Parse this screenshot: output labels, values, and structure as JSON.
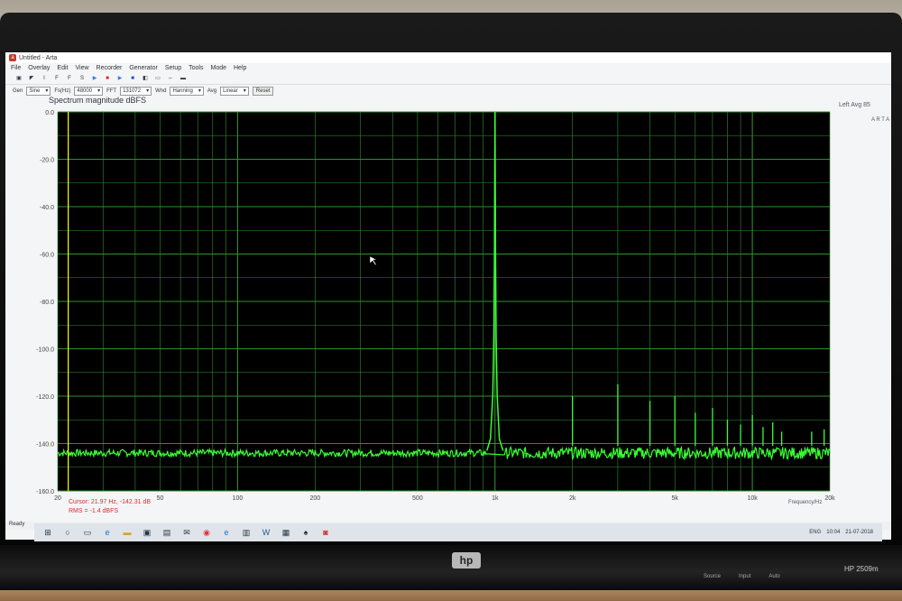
{
  "window": {
    "title": "Untitled - Arta"
  },
  "menu": [
    "File",
    "Overlay",
    "Edit",
    "View",
    "Recorder",
    "Generator",
    "Setup",
    "Tools",
    "Mode",
    "Help"
  ],
  "toolbar": {
    "labels": [
      "Gen",
      "Fs(Hz)",
      "FFT",
      "Wnd",
      "Avg"
    ],
    "values": [
      "Sine",
      "48000",
      "131072",
      "Hanning",
      "Linear"
    ],
    "reset": "Reset"
  },
  "chart_data": {
    "type": "line",
    "title": "Spectrum magnitude dBFS",
    "corner_label": "Left  Avg 85",
    "side_label": "A R T A",
    "xlabel": "Frequency/Hz",
    "ylabel": "",
    "xscale": "log",
    "xlim": [
      20,
      20000
    ],
    "ylim": [
      -160,
      0
    ],
    "yticks": [
      "0.0",
      "-20.0",
      "-40.0",
      "-60.0",
      "-80.0",
      "-100.0",
      "-120.0",
      "-140.0",
      "-160.0"
    ],
    "xticks": [
      "20",
      "50",
      "100",
      "200",
      "500",
      "1k",
      "2k",
      "5k",
      "10k",
      "20k"
    ],
    "grid": true,
    "noise_floor_db": -143,
    "series": [
      {
        "fundamental": {
          "x": 1000,
          "y": 0
        },
        "harmonics": [
          {
            "x": 2000,
            "y": -120
          },
          {
            "x": 3000,
            "y": -115
          },
          {
            "x": 4000,
            "y": -122
          },
          {
            "x": 5000,
            "y": -120
          },
          {
            "x": 6000,
            "y": -127
          },
          {
            "x": 7000,
            "y": -125
          },
          {
            "x": 8000,
            "y": -130
          },
          {
            "x": 9000,
            "y": -132
          },
          {
            "x": 10000,
            "y": -128
          },
          {
            "x": 11000,
            "y": -133
          },
          {
            "x": 12000,
            "y": -131
          },
          {
            "x": 13000,
            "y": -135
          },
          {
            "x": 17000,
            "y": -135
          },
          {
            "x": 19000,
            "y": -134
          }
        ]
      }
    ],
    "colors": {
      "trace": "#39ff33",
      "grid": "#2f8f2f",
      "background": "#000000",
      "cursor": "#ffff00"
    }
  },
  "cursor": {
    "readout": "Cursor: 21.97 Hz, -142.31 dB",
    "rms": "RMS = -1.4 dBFS"
  },
  "status": {
    "text": "Ready"
  },
  "taskbar": {
    "icons": [
      "windows-icon",
      "search-icon",
      "taskview-icon",
      "edge-icon",
      "folder-icon",
      "store-icon",
      "app-icon",
      "mail-icon",
      "chrome-icon",
      "ie-icon",
      "files-icon",
      "word-icon",
      "calculator-icon",
      "solitaire-icon",
      "arta-icon"
    ],
    "clock": "10:04",
    "date": "21-07-2018",
    "lang": "ENG"
  },
  "monitor": {
    "brand": "hp",
    "model": "HP 2509m",
    "buttons": [
      "Source",
      "Input",
      "Auto"
    ]
  }
}
